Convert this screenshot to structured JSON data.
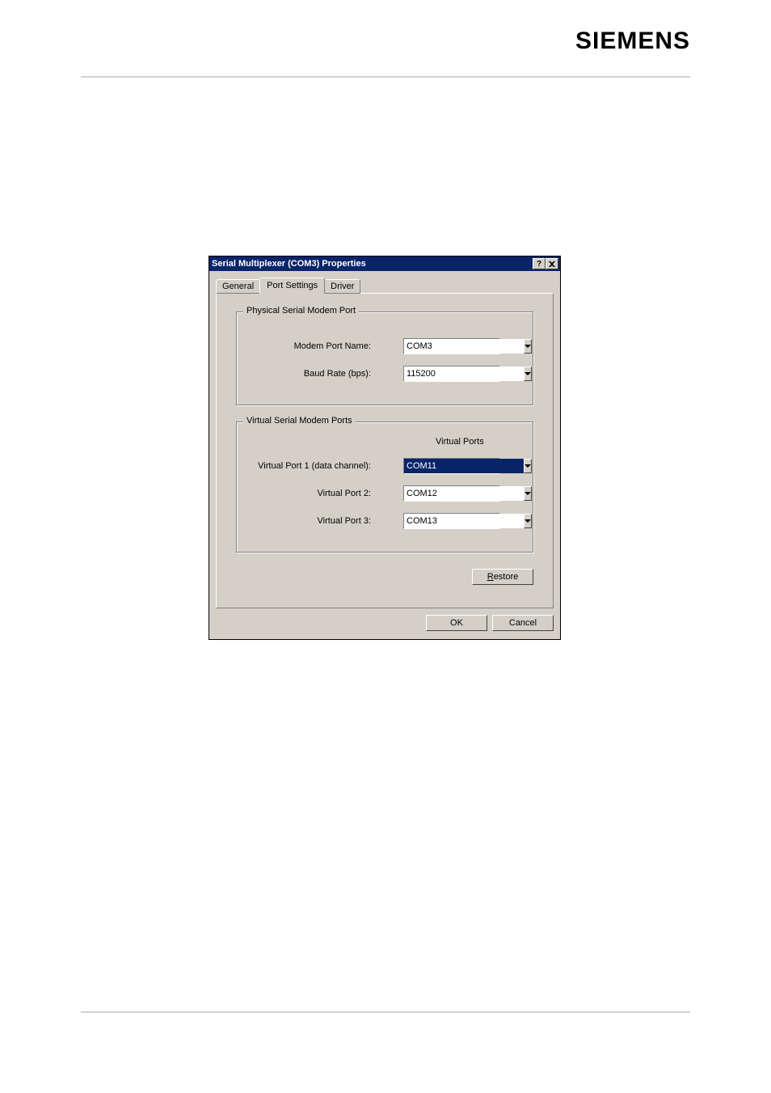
{
  "brand": "SIEMENS",
  "dialog": {
    "title": "Serial Multiplexer (COM3) Properties",
    "tabs": {
      "general": "General",
      "port_settings": "Port Settings",
      "driver": "Driver"
    },
    "groups": {
      "physical": {
        "legend": "Physical Serial Modem Port",
        "modem_port_label": "Modem Port Name:",
        "modem_port_value": "COM3",
        "baud_label": "Baud Rate (bps):",
        "baud_value": "115200"
      },
      "virtual": {
        "legend": "Virtual Serial Modem Ports",
        "header": "Virtual Ports",
        "vp1_label": "Virtual Port 1 (data channel):",
        "vp1_value": "COM11",
        "vp2_label": "Virtual Port 2:",
        "vp2_value": "COM12",
        "vp3_label": "Virtual Port 3:",
        "vp3_value": "COM13"
      }
    },
    "buttons": {
      "restore": "Restore",
      "ok": "OK",
      "cancel": "Cancel"
    }
  }
}
